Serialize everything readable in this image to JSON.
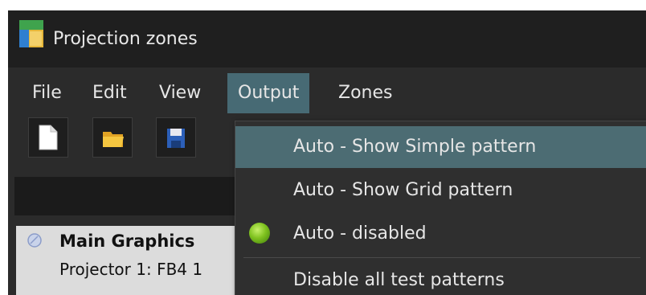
{
  "window": {
    "title": "Projection zones"
  },
  "menu": {
    "items": [
      {
        "label": "File"
      },
      {
        "label": "Edit"
      },
      {
        "label": "View"
      },
      {
        "label": "Output"
      },
      {
        "label": "Zones"
      }
    ],
    "active": "Output"
  },
  "toolbar": {
    "buttons": [
      {
        "icon": "new-document-icon"
      },
      {
        "icon": "open-folder-icon"
      },
      {
        "icon": "save-disk-icon"
      }
    ]
  },
  "list": {
    "items": [
      {
        "title": "Main Graphics",
        "subtitle": "Projector 1: FB4 1"
      }
    ]
  },
  "output_menu": {
    "items": [
      {
        "label": "Auto - Show Simple pattern",
        "highlighted": true,
        "checked": false
      },
      {
        "label": "Auto - Show Grid pattern",
        "highlighted": false,
        "checked": false
      },
      {
        "label": "Auto - disabled",
        "highlighted": false,
        "checked": true
      },
      {
        "label": "Disable all test patterns",
        "highlighted": false,
        "checked": false
      }
    ],
    "accent": "#4c6c73",
    "radio_color": "#7fc21f"
  }
}
